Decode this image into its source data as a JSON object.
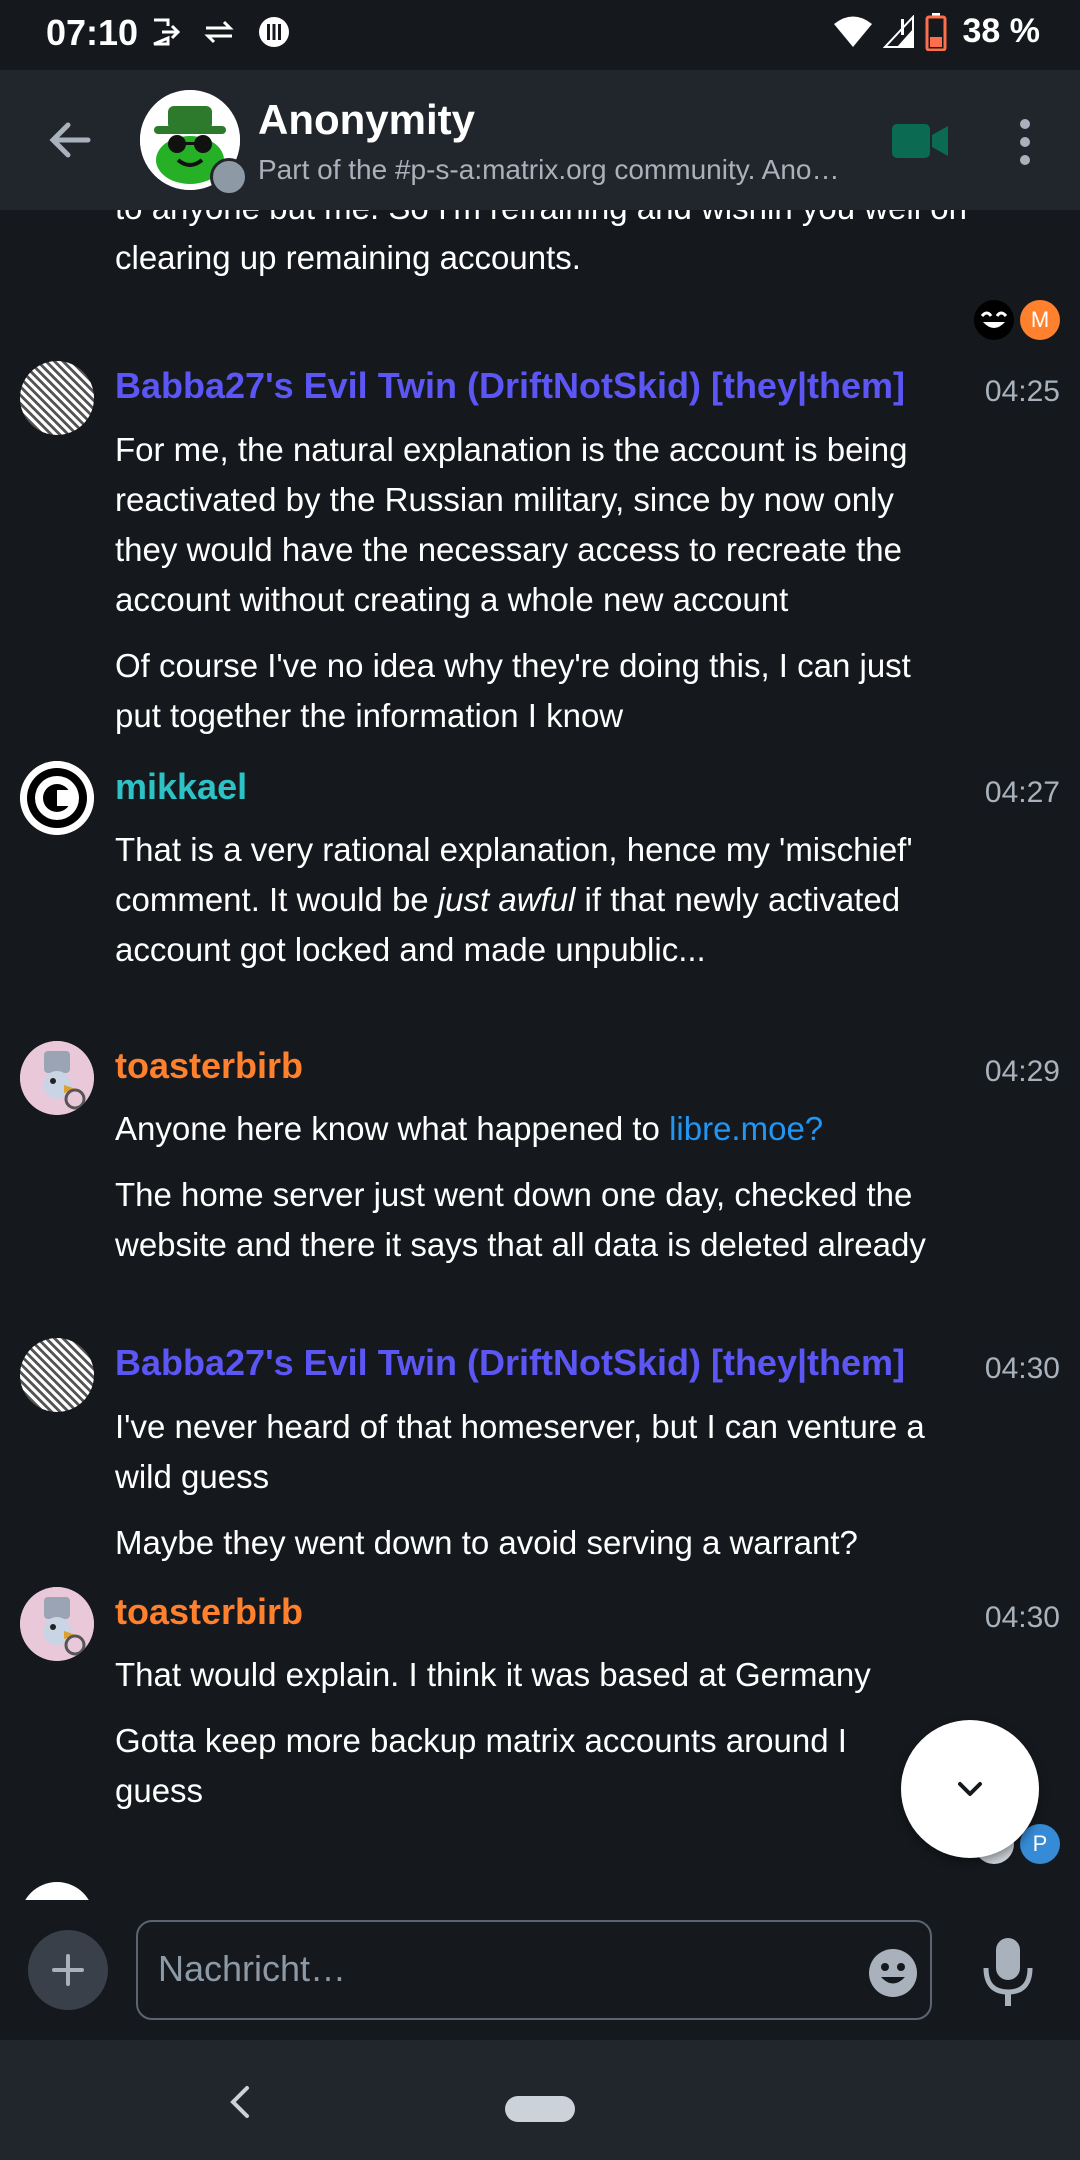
{
  "status_bar": {
    "time": "07:10",
    "battery": "38 %",
    "icons_left": [
      "exit-icon",
      "sync-icon",
      "grid-icon"
    ],
    "icons_right": [
      "wifi-icon",
      "signal-icon",
      "battery-icon"
    ]
  },
  "header": {
    "title": "Anonymity",
    "topic": "Part of the #p-s-a:matrix.org community. Anonymity and privacy related discussion",
    "icons": [
      "back-arrow-icon",
      "video-call-icon",
      "more-vert-icon"
    ]
  },
  "colors": {
    "background": "#15191e",
    "header": "#21262c",
    "sender_purple": "#5c56f5",
    "sender_teal": "#2dc2c5",
    "sender_orange": "#ff812d",
    "link": "#2196f3",
    "video_icon": "#0dbd8b"
  },
  "timeline": {
    "partial_message": "to anyone but me.  So I'm refraining and wishin you well on clearing up remaining accounts.",
    "receipt_top_letter": "M",
    "groups": [
      {
        "sender": "Babba27's Evil Twin (DriftNotSkid) [they|them]",
        "time": "04:25",
        "messages": [
          "For me, the natural explanation is the account is being reactivated by the Russian military, since by now only they would have the necessary access to recreate the account without creating a whole new account",
          "Of course I've no idea why they're doing this, I can just put together the information I know"
        ]
      },
      {
        "sender": "mikkael",
        "time": "04:27",
        "message_parts": {
          "before": "That is a very rational explanation, hence my 'mischief' comment. It would be ",
          "emphasis": "just awful",
          "after": " if that newly activated account got locked and made unpublic..."
        }
      },
      {
        "sender": "toasterbirb",
        "time": "04:29",
        "message1_text": "Anyone here know what happened to ",
        "message1_link": "libre.moe?",
        "message2": "The home server just went down one day, checked the website and there it says that all data is deleted already"
      },
      {
        "sender": "Babba27's Evil Twin (DriftNotSkid) [they|them]",
        "time": "04:30",
        "messages": [
          "I've never heard of that homeserver, but I can venture a wild guess",
          "Maybe they went down to avoid serving a warrant?"
        ]
      },
      {
        "sender": "toasterbirb",
        "time": "04:30",
        "messages": [
          "That would explain. I think it was based at Germany",
          "Gotta keep more backup matrix accounts around I guess"
        ]
      }
    ],
    "receipt_bottom_letter": "P"
  },
  "composer": {
    "placeholder": "Nachricht…",
    "icons": [
      "add-icon",
      "emoji-icon",
      "microphone-icon"
    ]
  },
  "scroll_button": {
    "icon": "chevron-down-icon"
  },
  "nav_bar": {
    "icons": [
      "nav-back-icon",
      "home-pill-icon"
    ]
  }
}
